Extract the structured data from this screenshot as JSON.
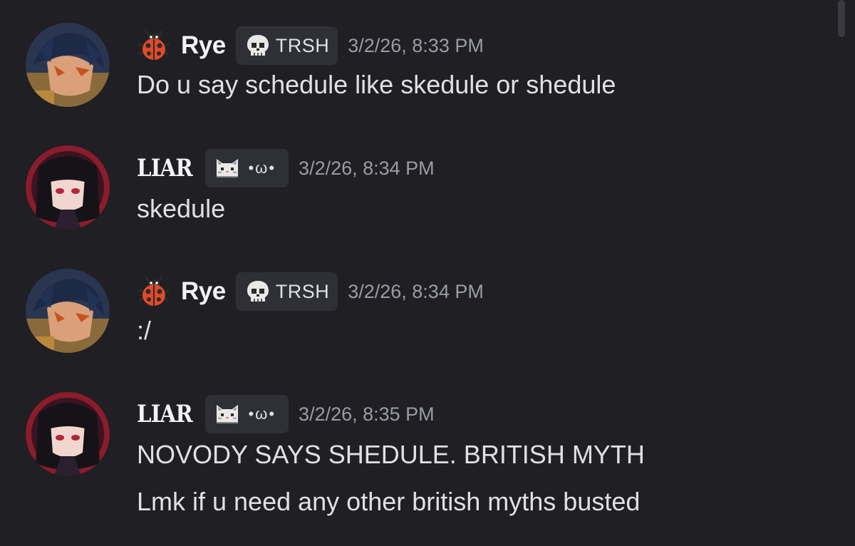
{
  "colors": {
    "background": "#1f1f24",
    "tag_background": "#2f3036",
    "username": "#f2f3f5",
    "timestamp": "#9a9da4",
    "text": "#dfe1e5"
  },
  "messages": [
    {
      "username": "Rye",
      "role_icon": "ladybug-icon",
      "tag_icon": "skull-icon",
      "tag": "TRSH",
      "timestamp": "3/2/26, 8:33 PM",
      "lines": [
        "Do u say schedule like skedule or shedule"
      ]
    },
    {
      "username": "LIAR",
      "role_icon": "none",
      "tag_icon": "cat-icon",
      "tag": "•ω•",
      "timestamp": "3/2/26, 8:34 PM",
      "lines": [
        "skedule"
      ]
    },
    {
      "username": "Rye",
      "role_icon": "ladybug-icon",
      "tag_icon": "skull-icon",
      "tag": "TRSH",
      "timestamp": "3/2/26, 8:34 PM",
      "lines": [
        ":/"
      ]
    },
    {
      "username": "LIAR",
      "role_icon": "none",
      "tag_icon": "cat-icon",
      "tag": "•ω•",
      "timestamp": "3/2/26, 8:35 PM",
      "lines": [
        "NOVODY SAYS SHEDULE. BRITISH MYTH",
        "Lmk if u need any other british myths busted"
      ]
    }
  ]
}
